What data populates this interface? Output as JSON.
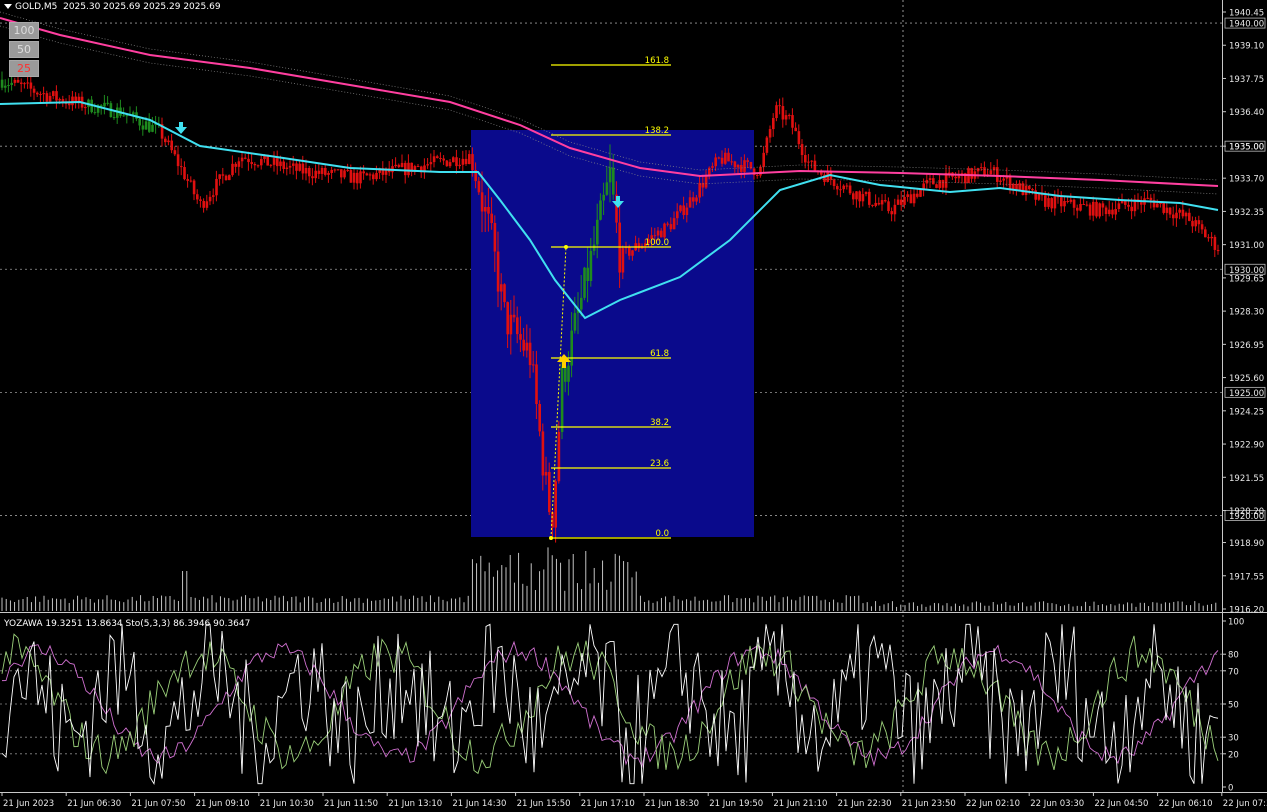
{
  "header": {
    "symbol": "GOLD,M5",
    "ohlc": "2025.30 2025.69 2025.29 2025.69"
  },
  "level_buttons": [
    {
      "label": "100",
      "color": "#d8d8d8"
    },
    {
      "label": "50",
      "color": "#d8d8d8"
    },
    {
      "label": "25",
      "color": "#ff4040"
    }
  ],
  "indicator": {
    "name": "YOZAWA",
    "values": "19.3251 13.8634",
    "stoch": "Sto(5,3,3) 86.3946 90.3647"
  },
  "price_axis": [
    "1940.45",
    "1939.10",
    "1937.75",
    "1936.40",
    "1935.00",
    "1933.70",
    "1932.35",
    "1931.00",
    "1929.65",
    "1928.30",
    "1926.95",
    "1925.60",
    "1924.25",
    "1922.90",
    "1921.55",
    "1920.20",
    "1918.90",
    "1917.55",
    "1916.20"
  ],
  "price_levels": [
    "1940.00",
    "1935.00",
    "1930.00",
    "1925.00",
    "1920.00"
  ],
  "osc_axis": [
    "100",
    "80",
    "70",
    "50",
    "30",
    "20",
    "0"
  ],
  "time_axis": [
    "21 Jun 2023",
    "21 Jun 06:30",
    "21 Jun 07:50",
    "21 Jun 09:10",
    "21 Jun 10:30",
    "21 Jun 11:50",
    "21 Jun 13:10",
    "21 Jun 14:30",
    "21 Jun 15:50",
    "21 Jun 17:10",
    "21 Jun 18:30",
    "21 Jun 19:50",
    "21 Jun 21:10",
    "21 Jun 22:30",
    "21 Jun 23:50",
    "22 Jun 02:10",
    "22 Jun 03:30",
    "22 Jun 04:50",
    "22 Jun 06:10",
    "22 Jun 07:30"
  ],
  "fib_levels": [
    "161.8",
    "138.2",
    "100.0",
    "61.8",
    "38.2",
    "23.6",
    "0.0"
  ],
  "colors": {
    "bull": "#1e8a1e",
    "bear": "#e01010",
    "ema_fast": "#40e0f0",
    "ema_slow": "#ff3fa0",
    "fib": "#ffff00",
    "zone": "#0a0a8c",
    "stoch_main": "#ffffff",
    "stoch_k": "#9bd07a",
    "stoch_d": "#d070d0"
  }
}
